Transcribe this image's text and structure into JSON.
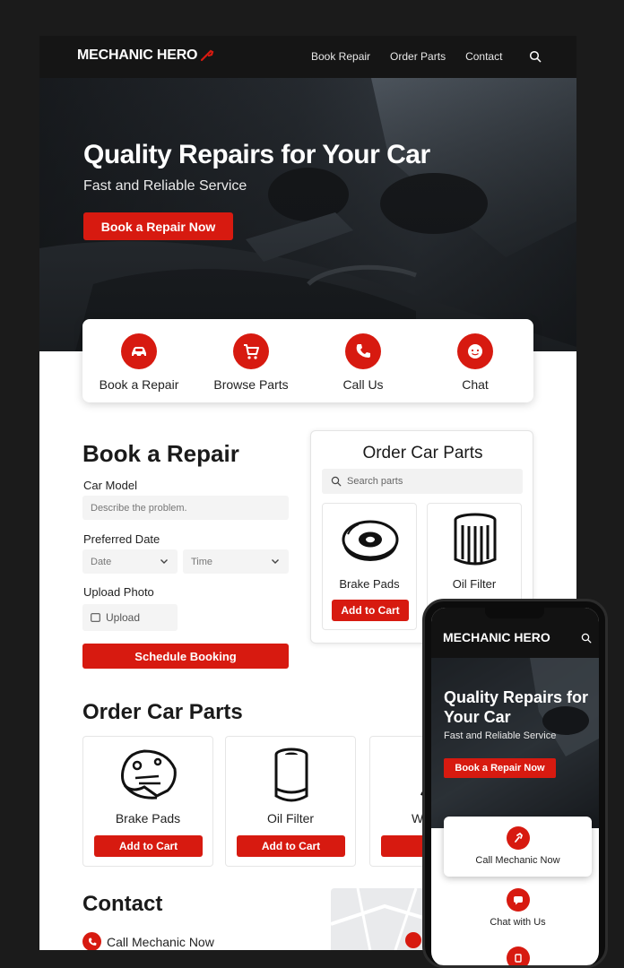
{
  "brand": {
    "name": "MECHANIC HERO",
    "accent": "#d71a10"
  },
  "nav": {
    "items": [
      "Book Repair",
      "Order Parts",
      "Contact"
    ],
    "search_icon": "search-icon"
  },
  "hero": {
    "title": "Quality Repairs for Your Car",
    "subtitle": "Fast and Reliable Service",
    "cta": "Book a Repair Now"
  },
  "quick_actions": [
    {
      "label": "Book a Repair",
      "icon": "car-icon"
    },
    {
      "label": "Browse Parts",
      "icon": "cart-icon"
    },
    {
      "label": "Call Us",
      "icon": "phone-icon"
    },
    {
      "label": "Chat",
      "icon": "chat-icon"
    }
  ],
  "booking": {
    "title": "Book a Repair",
    "car_model_label": "Car Model",
    "car_model_placeholder": "Describe the problem.",
    "date_label": "Preferred Date",
    "date_placeholder": "Date",
    "time_placeholder": "Time",
    "photo_label": "Upload Photo",
    "upload_label": "Upload",
    "submit": "Schedule Booking"
  },
  "order_panel": {
    "title": "Order Car Parts",
    "search_placeholder": "Search parts",
    "items": [
      {
        "name": "Brake Pads",
        "button": "Add to Cart"
      },
      {
        "name": "Oil Filter"
      }
    ]
  },
  "parts": {
    "title": "Order Car Parts",
    "items": [
      {
        "name": "Brake Pads",
        "button": "Add to Cart"
      },
      {
        "name": "Oil Filter",
        "button": "Add to Cart"
      },
      {
        "name": "Wipe",
        "button": "Add"
      }
    ]
  },
  "contact": {
    "title": "Contact",
    "call": "Call Mechanic Now"
  },
  "phone": {
    "brand": "MECHANIC HERO",
    "hero_title": "Quality Repairs for Your Car",
    "hero_subtitle": "Fast and Reliable Service",
    "cta": "Book a Repair Now",
    "call": "Call Mechanic Now",
    "chat": "Chat with Us"
  }
}
